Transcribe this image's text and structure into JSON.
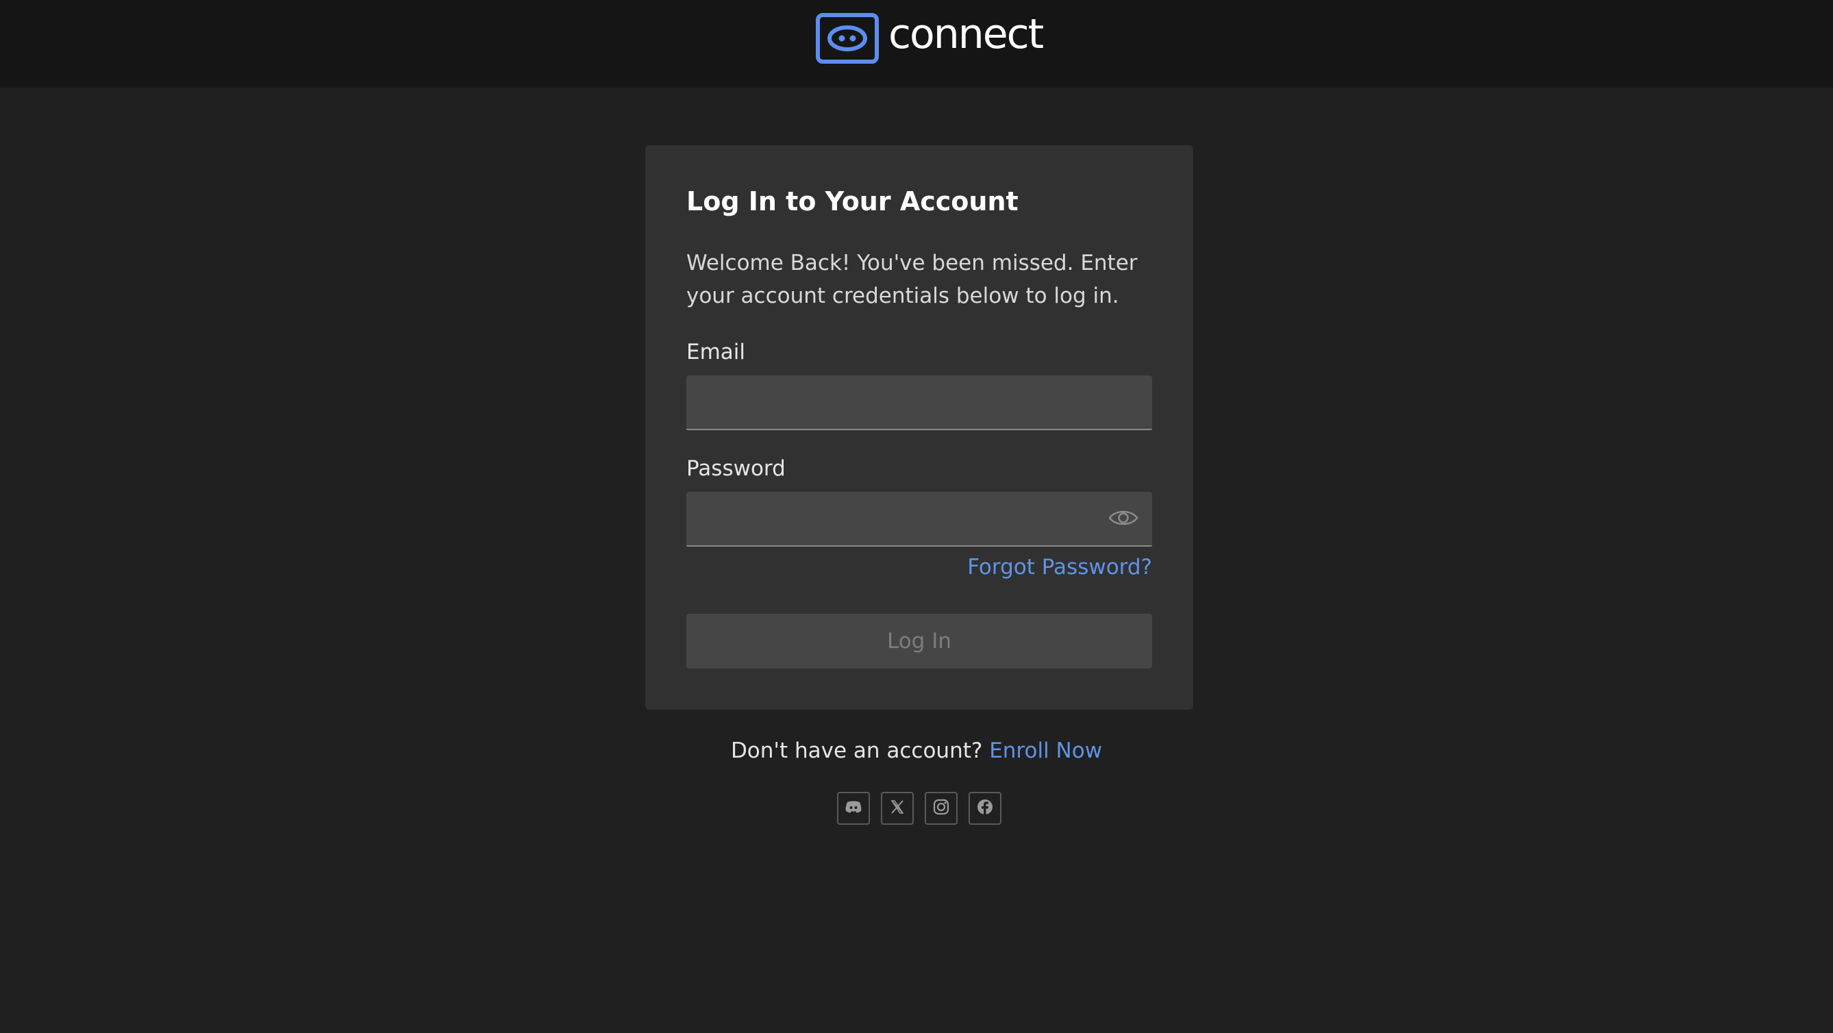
{
  "header": {
    "brand_name": "connect",
    "logo_icon": "robot-face-icon",
    "accent_color": "#5b8ef0"
  },
  "login_card": {
    "title": "Log In to Your Account",
    "description": "Welcome Back! You've been missed. Enter your account credentials below to log in.",
    "email": {
      "label": "Email",
      "value": "",
      "placeholder": ""
    },
    "password": {
      "label": "Password",
      "value": "",
      "placeholder": "",
      "toggle_icon": "eye-icon"
    },
    "forgot_password": "Forgot Password?",
    "submit_label": "Log In"
  },
  "signup": {
    "prompt": "Don't have an account?",
    "link": "Enroll Now"
  },
  "socials": [
    {
      "icon": "discord-icon"
    },
    {
      "icon": "x-icon"
    },
    {
      "icon": "instagram-icon"
    },
    {
      "icon": "facebook-icon"
    }
  ],
  "colors": {
    "link": "#5f94e6",
    "background": "#202020",
    "header": "#151515",
    "card": "#313131"
  }
}
